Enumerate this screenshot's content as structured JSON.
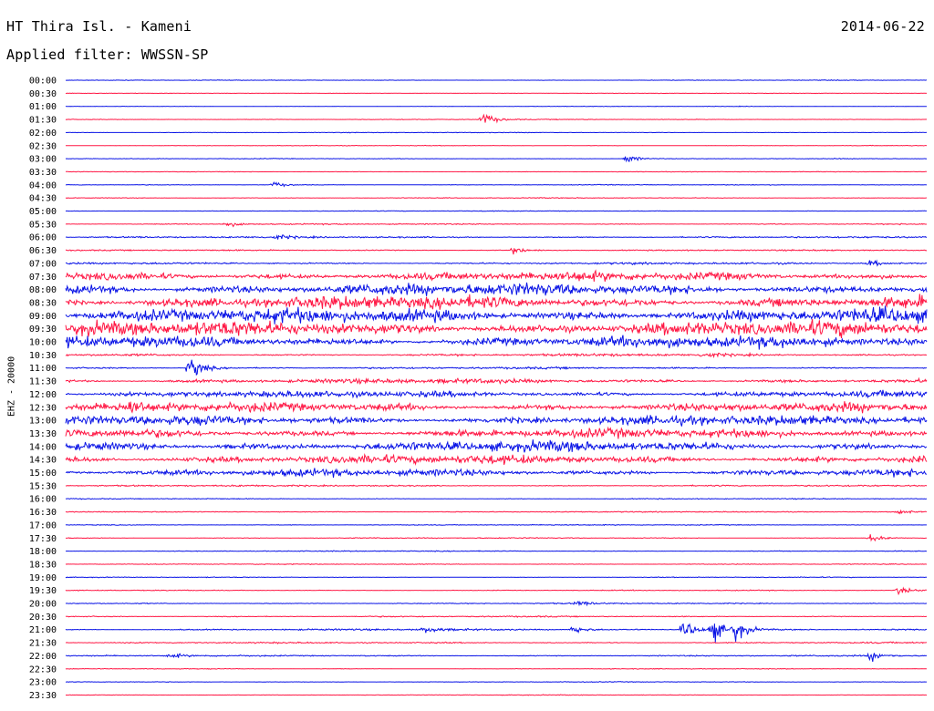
{
  "header": {
    "station": "HT Thira Isl. - Kameni",
    "date": "2014-06-22",
    "filter": "Applied filter: WWSSN-SP"
  },
  "channel_label": "EHZ - 20000",
  "colors": {
    "trace_a": "#0a14e6",
    "trace_b": "#ff1744"
  },
  "chart_data": {
    "type": "line",
    "title": "HT Thira Isl. - Kameni",
    "subtitle": "Applied filter: WWSSN-SP",
    "ylabel": "EHZ - 20000",
    "grid": false,
    "row_labels": [
      "00:00",
      "00:30",
      "01:00",
      "01:30",
      "02:00",
      "02:30",
      "03:00",
      "03:30",
      "04:00",
      "04:30",
      "05:00",
      "05:30",
      "06:00",
      "06:30",
      "07:00",
      "07:30",
      "08:00",
      "08:30",
      "09:00",
      "09:30",
      "10:00",
      "10:30",
      "11:00",
      "11:30",
      "12:00",
      "12:30",
      "13:00",
      "13:30",
      "14:00",
      "14:30",
      "15:00",
      "15:30",
      "16:00",
      "16:30",
      "17:00",
      "17:30",
      "18:00",
      "18:30",
      "19:00",
      "19:30",
      "20:00",
      "20:30",
      "21:00",
      "21:30",
      "22:00",
      "22:30",
      "23:00",
      "23:30"
    ],
    "series_colors": [
      "blue",
      "red"
    ],
    "activity_level": [
      0.4,
      0.4,
      0.4,
      0.5,
      0.5,
      0.5,
      0.5,
      0.4,
      0.6,
      0.6,
      0.5,
      0.9,
      1.3,
      1.0,
      1.6,
      7.0,
      9.5,
      10.0,
      11.0,
      11.5,
      9.0,
      2.0,
      1.5,
      3.5,
      5.0,
      7.0,
      7.5,
      7.0,
      8.0,
      7.0,
      5.5,
      1.2,
      0.7,
      0.8,
      0.7,
      0.8,
      0.7,
      0.6,
      0.6,
      0.7,
      0.9,
      1.0,
      1.3,
      1.1,
      1.0,
      0.6,
      0.5,
      0.5
    ],
    "events": [
      {
        "row": "01:30",
        "minute": 14.5,
        "amplitude": 14
      },
      {
        "row": "03:00",
        "minute": 19.5,
        "amplitude": 9
      },
      {
        "row": "04:00",
        "minute": 7.2,
        "amplitude": 6
      },
      {
        "row": "05:30",
        "minute": 5.6,
        "amplitude": 6
      },
      {
        "row": "06:00",
        "minute": 7.3,
        "amplitude": 5
      },
      {
        "row": "06:30",
        "minute": 15.6,
        "amplitude": 7
      },
      {
        "row": "07:00",
        "minute": 28.0,
        "amplitude": 6
      },
      {
        "row": "10:30",
        "minute": 22.2,
        "amplitude": 6
      },
      {
        "row": "11:00",
        "minute": 4.3,
        "amplitude": 26
      },
      {
        "row": "12:30",
        "minute": 2.2,
        "amplitude": 12
      },
      {
        "row": "16:30",
        "minute": 29.0,
        "amplitude": 6
      },
      {
        "row": "17:30",
        "minute": 28.0,
        "amplitude": 8
      },
      {
        "row": "19:30",
        "minute": 29.0,
        "amplitude": 8
      },
      {
        "row": "20:00",
        "minute": 17.8,
        "amplitude": 5
      },
      {
        "row": "21:00",
        "minute": 21.5,
        "amplitude": 22
      },
      {
        "row": "21:00",
        "minute": 22.5,
        "amplitude": 24
      },
      {
        "row": "21:00",
        "minute": 23.3,
        "amplitude": 22
      },
      {
        "row": "21:00",
        "minute": 17.6,
        "amplitude": 9
      },
      {
        "row": "21:00",
        "minute": 12.5,
        "amplitude": 7
      },
      {
        "row": "22:00",
        "minute": 3.6,
        "amplitude": 6
      },
      {
        "row": "22:00",
        "minute": 28.0,
        "amplitude": 10
      }
    ]
  }
}
